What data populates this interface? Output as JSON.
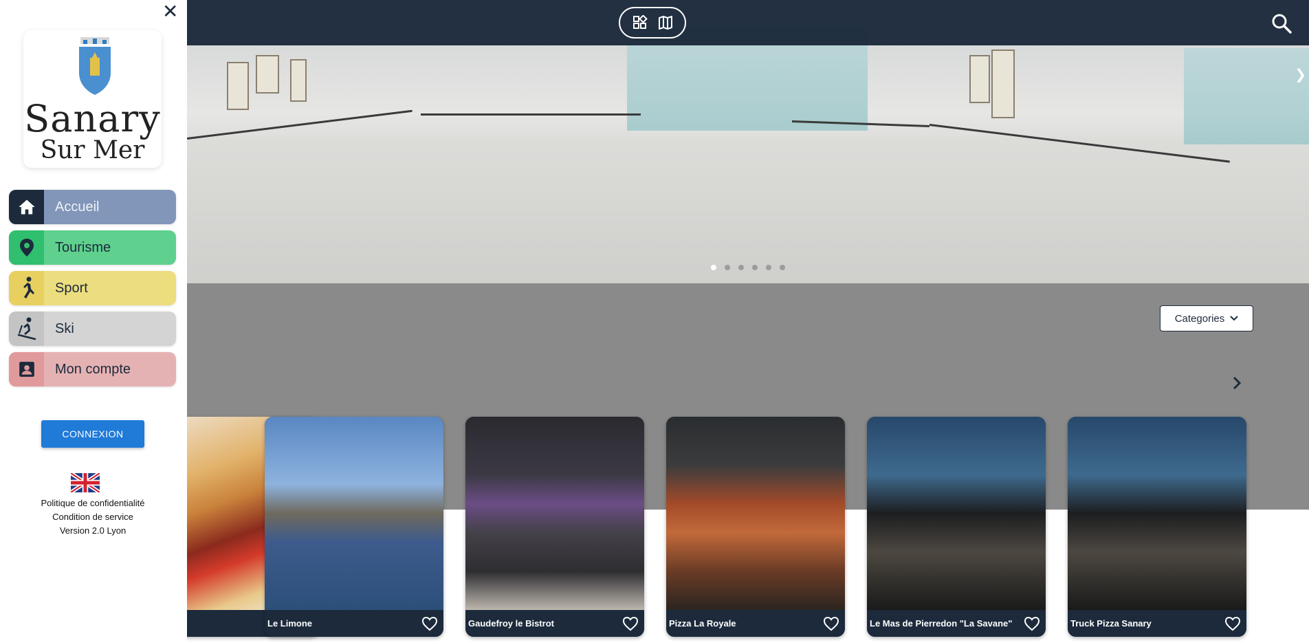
{
  "topbar": {
    "menu_icon": "hamburger-icon",
    "close_icon": "close-icon",
    "view_toggle": {
      "grid_icon": "grid-view-icon",
      "map_icon": "map-view-icon"
    },
    "search_icon": "search-icon"
  },
  "hero": {
    "slides_count": 6,
    "active_slide": 1
  },
  "sidebar": {
    "logo": {
      "line1": "Sanary",
      "line2": "Sur Mer"
    },
    "nav": [
      {
        "label": "Accueil",
        "icon": "home-icon",
        "color": "#8196b9",
        "icon_bg": "#1c2a3c"
      },
      {
        "label": "Tourisme",
        "icon": "location-pin-icon",
        "color": "#5fd08e",
        "icon_bg": "#2fbf6e"
      },
      {
        "label": "Sport",
        "icon": "runner-icon",
        "color": "#ecdd7e",
        "icon_bg": "#e8d060"
      },
      {
        "label": "Ski",
        "icon": "skier-icon",
        "color": "#d4d4d4",
        "icon_bg": "#c4c4c4"
      },
      {
        "label": "Mon compte",
        "icon": "account-box-icon",
        "color": "#e5b2b3",
        "icon_bg": "#e09a9c"
      }
    ],
    "connexion_label": "CONNEXION",
    "flag_icon": "uk-flag-icon",
    "links": {
      "privacy": "Politique de confidentialité",
      "terms": "Condition de service",
      "version": "Version 2.0 Lyon"
    }
  },
  "content": {
    "categories_label": "Categories",
    "next_icon": "chevron-right-icon",
    "cards": [
      {
        "title": "",
        "image": "burger"
      },
      {
        "title": "Le Limone",
        "image": "limone"
      },
      {
        "title": "Gaudefroy le Bistrot",
        "image": "gaudefroy"
      },
      {
        "title": "Pizza La Royale",
        "image": "pizza"
      },
      {
        "title": "Le Mas de Pierredon \"La Savane\"",
        "image": "mas"
      },
      {
        "title": "Truck Pizza Sanary",
        "image": "mas"
      }
    ]
  },
  "colors": {
    "navy": "#1c2a3c",
    "button_blue": "#1f7ad8",
    "grey_band": "#8a8a8a"
  }
}
